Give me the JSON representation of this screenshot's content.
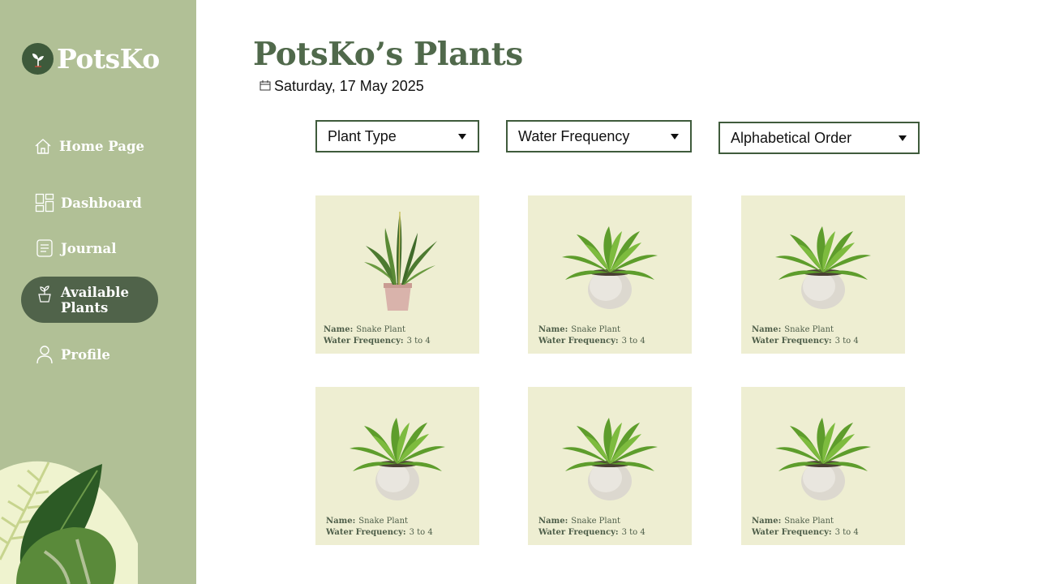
{
  "app": {
    "name": "PotsKo",
    "colors": {
      "sidebar": "#b1c096",
      "accent": "#50634a",
      "title": "#50694b",
      "card": "#eeeed2"
    }
  },
  "sidebar": {
    "items": [
      {
        "label": "Home Page",
        "icon": "home-icon"
      },
      {
        "label": "Dashboard",
        "icon": "dashboard-icon"
      },
      {
        "label": "Journal",
        "icon": "journal-icon"
      },
      {
        "label": "Available Plants",
        "icon": "plant-pot-icon",
        "active": true
      },
      {
        "label": "Profile",
        "icon": "user-icon"
      }
    ]
  },
  "header": {
    "title": "PotsKo’s Plants",
    "date": "Saturday, 17 May 2025"
  },
  "filters": [
    {
      "label": "Plant Type"
    },
    {
      "label": "Water Frequency"
    },
    {
      "label": "Alphabetical Order"
    }
  ],
  "cards": [
    {
      "name_label": "Name:",
      "name": "Snake Plant",
      "water_label": "Water Frequency:",
      "water": "3 to 4",
      "image": "snake-plant"
    },
    {
      "name_label": "Name:",
      "name": "Snake Plant",
      "water_label": "Water Frequency:",
      "water": "3 to 4",
      "image": "fern-plant"
    },
    {
      "name_label": "Name:",
      "name": "Snake Plant",
      "water_label": "Water Frequency:",
      "water": "3 to 4",
      "image": "fern-plant"
    },
    {
      "name_label": "Name:",
      "name": "Snake Plant",
      "water_label": "Water Frequency:",
      "water": "3 to 4",
      "image": "fern-plant"
    },
    {
      "name_label": "Name:",
      "name": "Snake Plant",
      "water_label": "Water Frequency:",
      "water": "3 to 4",
      "image": "fern-plant"
    },
    {
      "name_label": "Name:",
      "name": "Snake Plant",
      "water_label": "Water Frequency:",
      "water": "3 to 4",
      "image": "fern-plant"
    }
  ]
}
